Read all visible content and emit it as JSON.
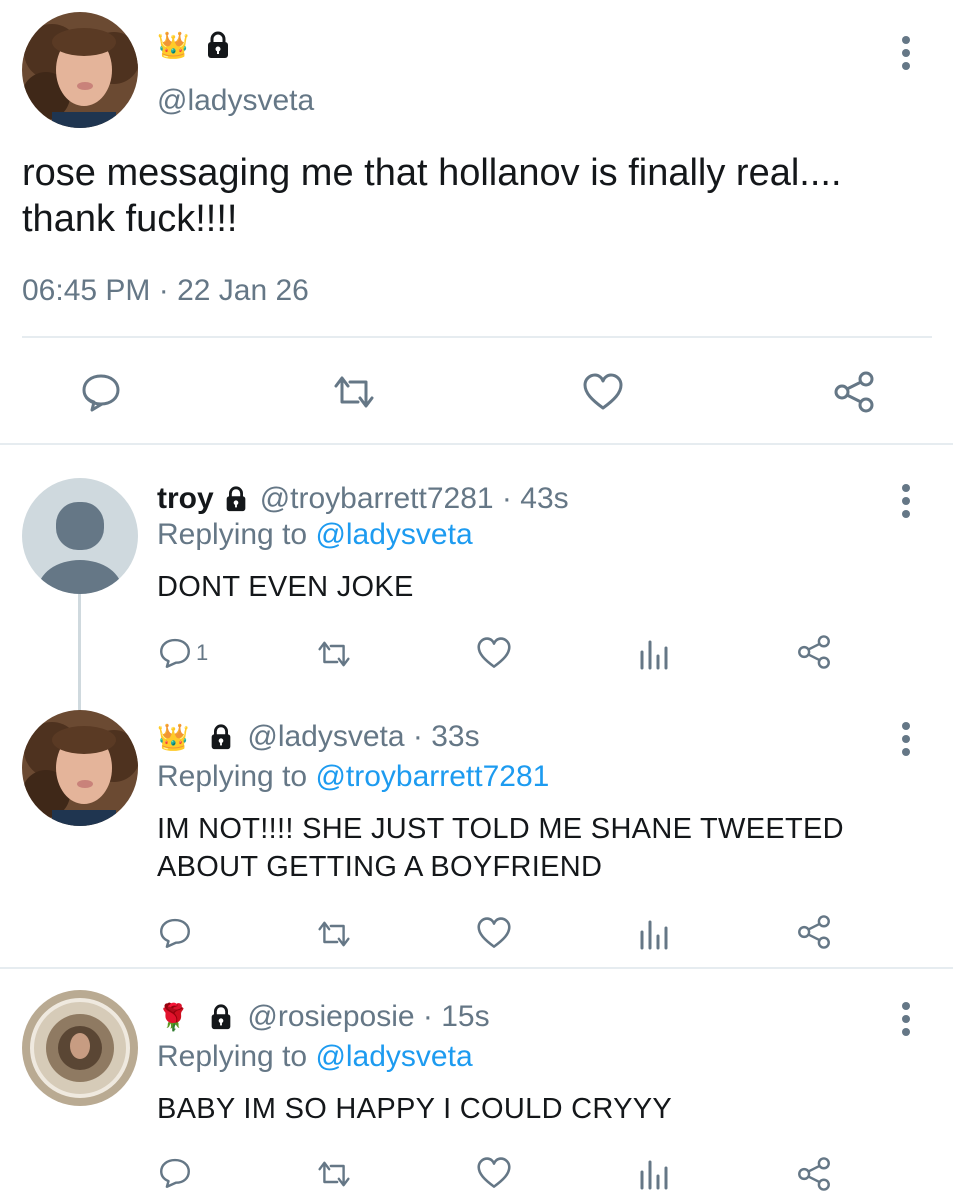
{
  "colors": {
    "accent": "#1d9bf0",
    "muted": "#657786",
    "text": "#14171a",
    "divider": "#e6ecf0"
  },
  "main_tweet": {
    "badges": [
      "crown-emoji",
      "lock-icon"
    ],
    "crown": "👑",
    "handle": "@ladysveta",
    "text_line1": "rose messaging me that hollanov is finally real....",
    "text_line2": "thank fuck!!!!",
    "timestamp": "06:45 PM · 22 Jan 26",
    "actions": [
      "comment-icon",
      "retweet-icon",
      "heart-icon",
      "share-icon"
    ]
  },
  "replies": [
    {
      "name": "troy",
      "handle_time": "@troybarrett7281 · 43s",
      "replying_prefix": "Replying to ",
      "replying_handle": "@ladysveta",
      "text_line1": "DONT EVEN JOKE",
      "text_line2": "",
      "comment_count": "1"
    },
    {
      "badge_emoji": "👑",
      "handle_time": "@ladysveta · 33s",
      "replying_prefix": "Replying to ",
      "replying_handle": "@troybarrett7281",
      "text_line1": "IM NOT!!!! SHE JUST TOLD ME SHANE TWEETED",
      "text_line2": "ABOUT GETTING A BOYFRIEND"
    },
    {
      "badge_emoji": "🌹",
      "handle_time": "@rosieposie · 15s",
      "replying_prefix": "Replying to ",
      "replying_handle": "@ladysveta",
      "text_line1": "BABY IM SO HAPPY I COULD CRYYY",
      "text_line2": ""
    }
  ]
}
